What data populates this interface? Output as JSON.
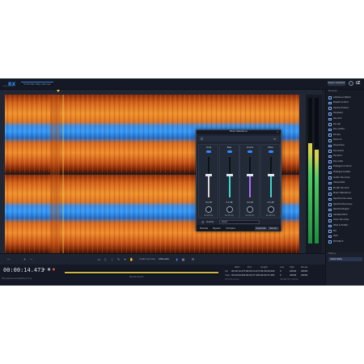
{
  "app": {
    "logo": "RX",
    "logo_sub": "AUDIO EDITOR",
    "file_tab": "Hi Fat Take! Billy Cafe.wav",
    "repair_button": "Repair Assistant",
    "help_icon": "?",
    "brand_icon": "iZ"
  },
  "modules": {
    "header": "Modules",
    "items": [
      {
        "label": "Ambience Match",
        "icon": "ambience-match-icon"
      },
      {
        "label": "Breath Control",
        "icon": "breath-control-icon"
      },
      {
        "label": "Center Extract",
        "icon": "center-extract-icon"
      },
      {
        "label": "De-bleed",
        "icon": "de-bleed-icon"
      },
      {
        "label": "De-click",
        "icon": "de-click-icon"
      },
      {
        "label": "De-clip",
        "icon": "de-clip-icon"
      },
      {
        "label": "De-crackle",
        "icon": "de-crackle-icon"
      },
      {
        "label": "De-ess",
        "icon": "de-ess-icon"
      },
      {
        "label": "De-hum",
        "icon": "de-hum-icon"
      },
      {
        "label": "De-plosive",
        "icon": "de-plosive-icon"
      },
      {
        "label": "De-reverb",
        "icon": "de-reverb-icon"
      },
      {
        "label": "De-wind",
        "icon": "de-wind-icon"
      },
      {
        "label": "De-rustle",
        "icon": "de-rustle-icon"
      },
      {
        "label": "Dialogue Contour",
        "icon": "dialogue-contour-icon"
      },
      {
        "label": "Dialogue Isolate",
        "icon": "dialogue-isolate-icon"
      },
      {
        "label": "Guitar De-noise",
        "icon": "guitar-denoise-icon"
      },
      {
        "label": "Interpolate",
        "icon": "interpolate-icon"
      },
      {
        "label": "Mouth De-click",
        "icon": "mouth-declick-icon"
      },
      {
        "label": "Music Rebalance",
        "icon": "music-rebalance-icon"
      },
      {
        "label": "Spectral De-noise",
        "icon": "spectral-denoise-icon"
      },
      {
        "label": "Spectral Recovery",
        "icon": "spectral-recovery-icon"
      },
      {
        "label": "Spectral Repair",
        "icon": "spectral-repair-icon"
      },
      {
        "label": "Variable Pitch",
        "icon": "variable-pitch-icon"
      },
      {
        "label": "Voice De-noise",
        "icon": "voice-denoise-icon"
      },
      {
        "label": "Wow & Flutter",
        "icon": "wow-flutter-icon"
      },
      {
        "label": "EQ",
        "icon": "eq-icon"
      },
      {
        "label": "Gain",
        "icon": "gain-icon"
      },
      {
        "label": "EQ Match",
        "icon": "eq-match-icon"
      }
    ]
  },
  "history": {
    "header": "History",
    "items": [
      "Initial State"
    ]
  },
  "dialog": {
    "title": "Music Rebalance",
    "bands": [
      {
        "label": "Vocal",
        "value": "0.0 dB",
        "knob_label": "Sensitivity",
        "level": 0.55,
        "color": "#d7d7d7"
      },
      {
        "label": "Bass",
        "value": "0.0 dB",
        "knob_label": "Sensitivity",
        "level": 0.55,
        "color": "#3fd6c9"
      },
      {
        "label": "Drums",
        "value": "0.0 dB",
        "knob_label": "Sensitivity",
        "level": 0.55,
        "color": "#b06bff"
      },
      {
        "label": "Other",
        "value": "0.0 dB",
        "knob_label": "Sensitivity",
        "level": 0.55,
        "color": "#3fd6c9"
      }
    ],
    "quality_label": "Quality",
    "quality_value": "Good",
    "buttons": {
      "preview": "Preview",
      "bypass": "Bypass",
      "compare": "Compare",
      "separate": "Separate",
      "render": "Render"
    }
  },
  "toolbar": {
    "instant_process": "Instant process",
    "instant_mode": "Attenuate"
  },
  "transport": {
    "time": "00:00:14.473",
    "status": "File opened successfully (1.1 s)",
    "timecode_label": "00:00:14.473"
  },
  "selection_info": {
    "headers": [
      "Start",
      "End",
      "Length",
      "Low",
      "High",
      "Range"
    ],
    "sel_label": "Sel",
    "view_label": "View",
    "sel_values": [
      "00:00:14.473",
      "00:00:14.473",
      "00:00:00.000",
      "0",
      "20000",
      "20000"
    ],
    "view_values": [
      "00:00:00.000",
      "00:00:37.483",
      "00:00:37.483",
      "0",
      "20000",
      "20000"
    ],
    "format": "hh:mm:ss.ms",
    "sample_rate": "44100 Hz | 24-bit"
  },
  "colors": {
    "accent": "#2e8fff",
    "spectrogram_low": "#c04a10",
    "spectrogram_mid": "#e8832a",
    "spectrogram_high": "#2f9bff"
  }
}
